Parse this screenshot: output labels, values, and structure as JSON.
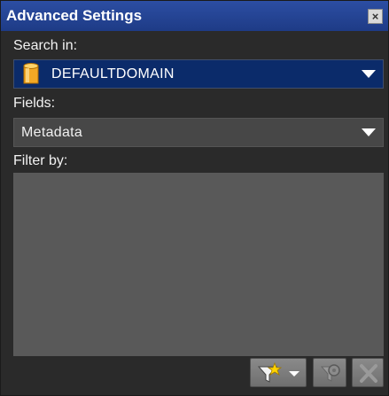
{
  "window": {
    "title": "Advanced Settings"
  },
  "search": {
    "label": "Search in:",
    "selected": "DEFAULTDOMAIN",
    "icon": "database-icon"
  },
  "fields": {
    "label": "Fields:",
    "selected": "Metadata"
  },
  "filter": {
    "label": "Filter by:"
  },
  "toolbar": {
    "add_filter_icon": "filter-star-icon",
    "edit_filter_icon": "filter-gear-icon",
    "delete_filter_icon": "delete-x-icon"
  },
  "colors": {
    "titlebar": "#1e3b86",
    "panel": "#2a2a2a",
    "selected_dropdown": "#0b2b6a",
    "dropdown": "#474747",
    "filter_area": "#595959"
  }
}
